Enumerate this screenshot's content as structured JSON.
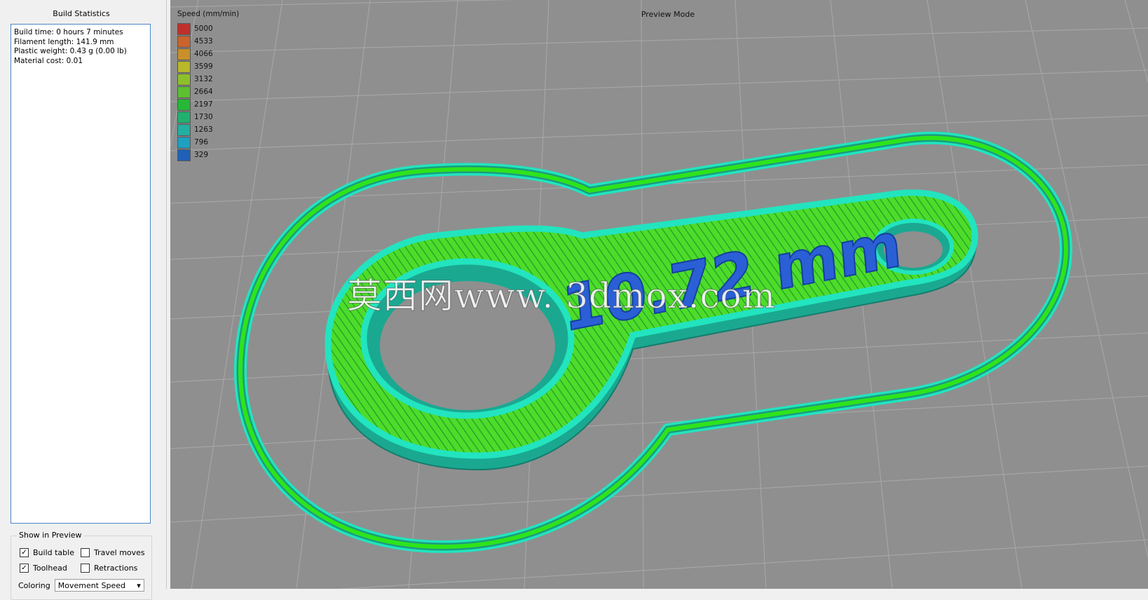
{
  "left_panel": {
    "title": "Build Statistics",
    "stats": [
      "Build time: 0 hours 7 minutes",
      "Filament length: 141.9 mm",
      "Plastic weight: 0.43 g (0.00 lb)",
      "Material cost: 0.01"
    ],
    "show_in_preview": {
      "title": "Show in Preview",
      "options": [
        {
          "label": "Build table",
          "checked": true
        },
        {
          "label": "Travel moves",
          "checked": false
        },
        {
          "label": "Toolhead",
          "checked": true
        },
        {
          "label": "Retractions",
          "checked": false
        }
      ],
      "coloring_label": "Coloring",
      "coloring_value": "Movement Speed"
    }
  },
  "viewport": {
    "mode_label": "Preview Mode",
    "legend_title": "Speed (mm/min)",
    "legend": [
      {
        "value": "5000",
        "color": "#c0302a"
      },
      {
        "value": "4533",
        "color": "#c8642c"
      },
      {
        "value": "4066",
        "color": "#c8902a"
      },
      {
        "value": "3599",
        "color": "#b8b82a"
      },
      {
        "value": "3132",
        "color": "#8cc02a"
      },
      {
        "value": "2664",
        "color": "#5cc030"
      },
      {
        "value": "2197",
        "color": "#28b838"
      },
      {
        "value": "1730",
        "color": "#22b070"
      },
      {
        "value": "1263",
        "color": "#22b0a0"
      },
      {
        "value": "796",
        "color": "#1ea0c0"
      },
      {
        "value": "329",
        "color": "#2060b8"
      }
    ],
    "part_text": "10.72 mm",
    "watermark": "莫西网www. 3dmox.com",
    "colors": {
      "background": "#8f8f8f",
      "grid_line": "#a8a8a8",
      "skirt_inner": "#2ee41a",
      "skirt_outer": "#2ee8c0",
      "wall": "#1aa891",
      "top_infill": "#4edc2a",
      "text": "#2a5fd6"
    }
  }
}
